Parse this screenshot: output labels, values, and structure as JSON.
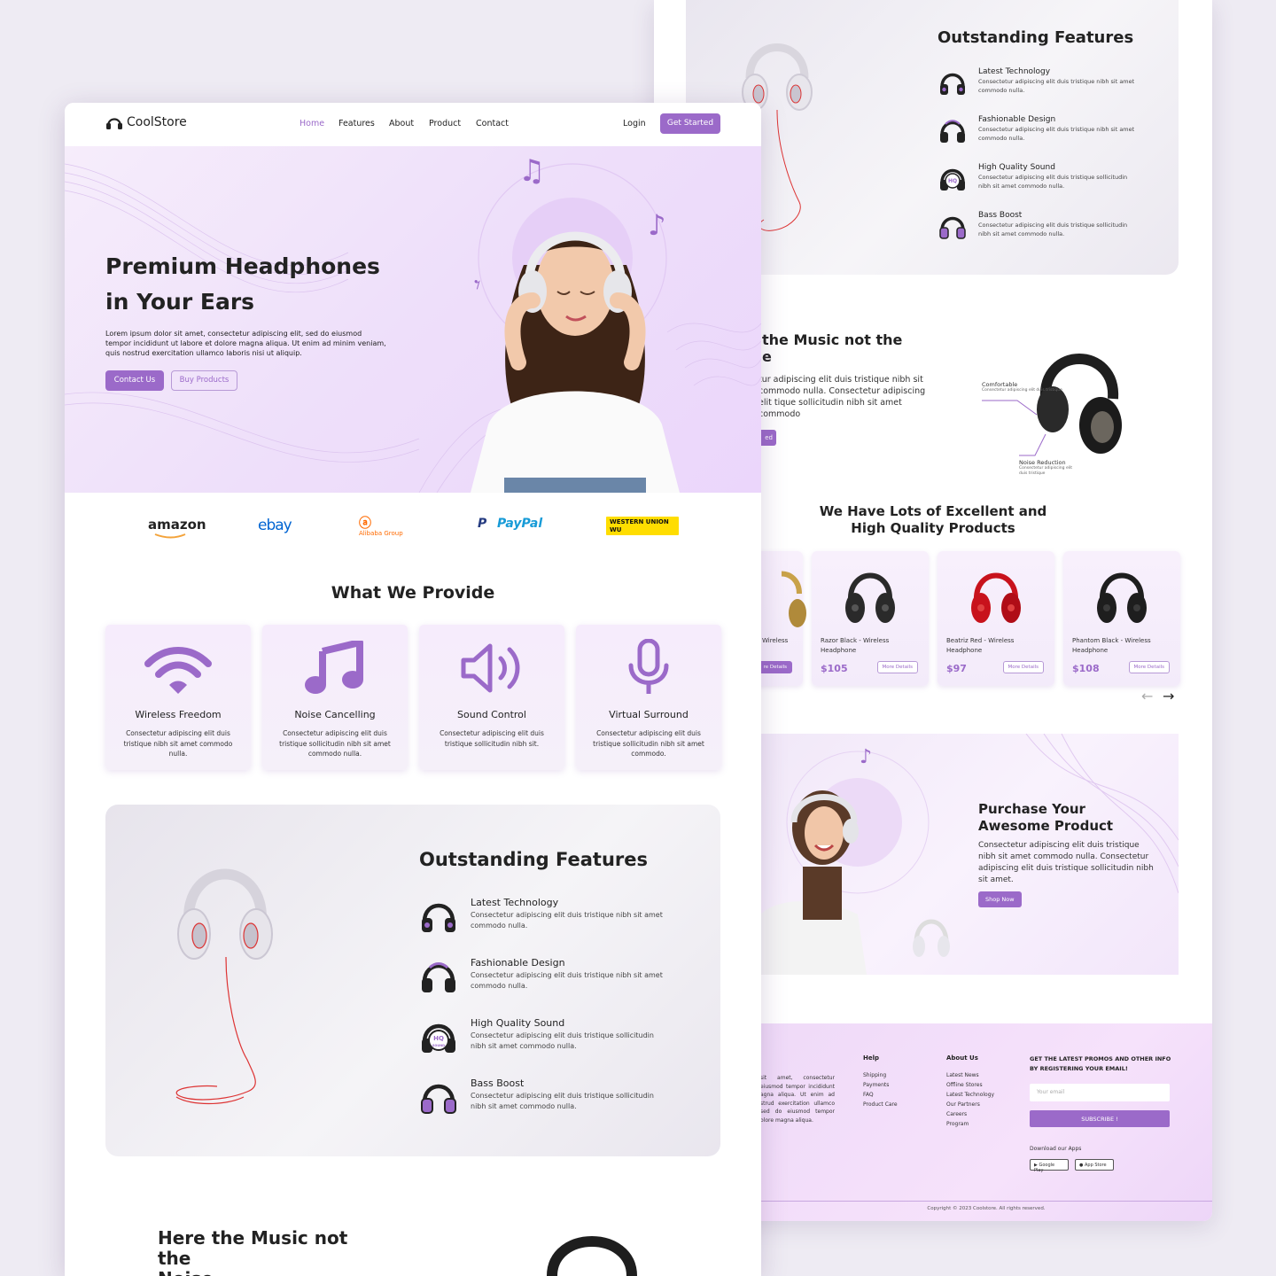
{
  "brand": {
    "name": "CoolStore",
    "accent": "#9b6ac9"
  },
  "nav": {
    "items": [
      "Home",
      "Features",
      "About",
      "Product",
      "Contact"
    ],
    "login": "Login",
    "cta": "Get Started"
  },
  "hero": {
    "title_line1": "Premium Headphones",
    "title_line2": "in Your Ears",
    "text": "Lorem ipsum dolor sit amet, consectetur adipiscing elit, sed do eiusmod tempor incididunt ut labore et dolore magna aliqua. Ut enim ad minim veniam, quis nostrud exercitation ullamco laboris nisi ut aliquip.",
    "btn_contact": "Contact Us",
    "btn_buy": "Buy Products"
  },
  "partners": [
    "amazon",
    "ebay",
    "Alibaba Group",
    "PayPal",
    "WESTERN UNION WU"
  ],
  "provide": {
    "title": "What We Provide",
    "cards": [
      {
        "title": "Wireless Freedom",
        "text": "Consectetur adipiscing elit duis tristique nibh sit amet commodo nulla.",
        "icon": "wifi-icon"
      },
      {
        "title": "Noise Cancelling",
        "text": "Consectetur adipiscing elit duis tristique sollicitudin nibh sit amet commodo nulla.",
        "icon": "music-note-icon"
      },
      {
        "title": "Sound Control",
        "text": "Consectetur adipiscing elit duis tristique sollicitudin nibh sit.",
        "icon": "speaker-icon"
      },
      {
        "title": "Virtual Surround",
        "text": "Consectetur adipiscing elit duis tristique sollicitudin nibh sit amet commodo.",
        "icon": "microphone-icon"
      }
    ]
  },
  "features": {
    "title": "Outstanding Features",
    "items": [
      {
        "title": "Latest Technology",
        "text": "Consectetur adipiscing elit duis tristique nibh sit amet commodo nulla."
      },
      {
        "title": "Fashionable Design",
        "text": "Consectetur adipiscing elit duis tristique nibh sit amet commodo nulla."
      },
      {
        "title": "High Quality Sound",
        "text": "Consectetur adipiscing elit duis tristique sollicitudin nibh sit amet commodo nulla."
      },
      {
        "title": "Bass Boost",
        "text": "Consectetur adipiscing elit duis tristique sollicitudin nibh sit amet commodo nulla."
      }
    ],
    "hq_badge": "HQ SOUND"
  },
  "music": {
    "title_line1": "Here the Music not the",
    "title_line2": "Noise",
    "back_title_line1": "the Music not the",
    "back_title_line2": "e",
    "back_text": "tur adipiscing elit duis tristique nibh sit commodo nulla. Consectetur adipiscing elit tique sollicitudin nibh sit amet commodo",
    "back_btn": "ed",
    "label_comfortable": "Comfortable",
    "label_comfortable_sub": "Consectetur adipiscing elit duis tristique",
    "label_noise": "Noise Reduction",
    "label_noise_sub": "Consectetur adipiscing elit duis tristique"
  },
  "products": {
    "title_line1": "We Have Lots of Excellent and",
    "title_line2": "High Quality Products",
    "partial_name": "Wireless",
    "partial_btn": "re Details",
    "more_label": "More Details",
    "items": [
      {
        "name": "Razor Black - Wireless Headphone",
        "price": "$105",
        "color": "#2a2a2a"
      },
      {
        "name": "Beatriz Red - Wireless Headphone",
        "price": "$97",
        "color": "#c8121c"
      },
      {
        "name": "Phantom Black - Wireless Headphone",
        "price": "$108",
        "color": "#1e1e1e"
      }
    ],
    "prev": "←",
    "next": "→"
  },
  "purchase": {
    "title_line1": "Purchase Your",
    "title_line2": "Awesome Product",
    "text": "Consectetur adipiscing elit duis tristique nibh sit amet commodo nulla. Consectetur adipiscing elit duis tristique sollicitudin nibh sit amet.",
    "btn": "Shop Now"
  },
  "footer": {
    "about_text": "sit amet, consectetur eiusmod tempor incididunt agna aliqua. Ut enim ad strud exercitation ullamco sed do eiusmod tempor olore magna aliqua.",
    "help_title": "Help",
    "help_items": [
      "Shipping",
      "Payments",
      "FAQ",
      "Product Care"
    ],
    "about_title": "About Us",
    "about_items": [
      "Latest News",
      "Offline Stores",
      "Latest Technology",
      "Our Partners",
      "Careers",
      "Program"
    ],
    "promo_title": "GET THE LATEST PROMOS AND OTHER INFO BY REGISTERING YOUR EMAIL!",
    "email_placeholder": "Your email",
    "subscribe": "SUBSCRIBE !",
    "apps_label": "Download our Apps",
    "google_play": "Google Play",
    "app_store": "App Store",
    "copyright": "Copyright © 2023 Coolstore. All rights reserved."
  }
}
